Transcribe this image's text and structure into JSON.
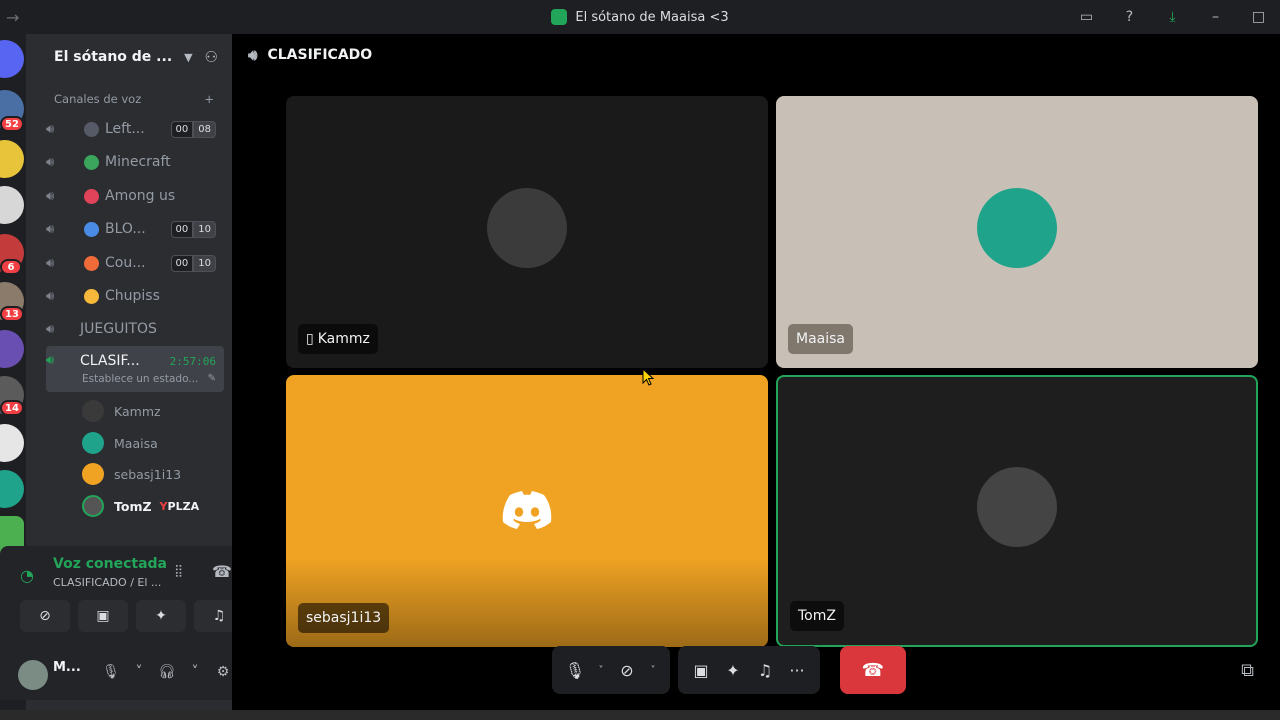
{
  "window": {
    "title": "El sótano de Maaisa <3",
    "icons": [
      "inbox-icon",
      "help-icon",
      "download-icon",
      "minimize-icon",
      "maximize-icon"
    ]
  },
  "rail": {
    "badges": [
      "52",
      "6",
      "13",
      "14"
    ]
  },
  "server": {
    "name": "El sótano de ...",
    "category": "Canales de voz"
  },
  "channels": [
    {
      "name": "Left...",
      "emoji_color": "#555a66",
      "count": [
        "00",
        "08"
      ]
    },
    {
      "name": "Minecraft",
      "emoji_color": "#3ba55d"
    },
    {
      "name": "Among us",
      "emoji_color": "#e0435a"
    },
    {
      "name": "BLO...",
      "emoji_color": "#4a8be6",
      "count": [
        "00",
        "10"
      ]
    },
    {
      "name": "Cou...",
      "emoji_color": "#ef6c3a",
      "count": [
        "00",
        "10"
      ]
    },
    {
      "name": "Chupiss",
      "emoji_color": "#f5b83b"
    },
    {
      "name": "JUEGUITOS"
    }
  ],
  "active_channel": {
    "name": "CLASIF...",
    "timer": "2:57:06",
    "status": "Establece un estado..."
  },
  "members": [
    {
      "name": "Kammz"
    },
    {
      "name": "Maaisa"
    },
    {
      "name": "sebasj1i13"
    },
    {
      "name": "TomZ",
      "tag_y": "Y",
      "tag_text": "PLZA"
    }
  ],
  "voice_panel": {
    "title": "Voz conectada",
    "subtitle": "CLASIFICADO / El ...",
    "user": "M..."
  },
  "main": {
    "channel_title": "CLASIFICADO"
  },
  "tiles": [
    {
      "name": "Kammz",
      "mobile": true
    },
    {
      "name": "Maaisa"
    },
    {
      "name": "sebasj1i13"
    },
    {
      "name": "TomZ",
      "speaking": true
    }
  ],
  "colors": {
    "accent_green": "#23a559",
    "danger_red": "#da373c",
    "discord_tile": "#f0a323"
  }
}
